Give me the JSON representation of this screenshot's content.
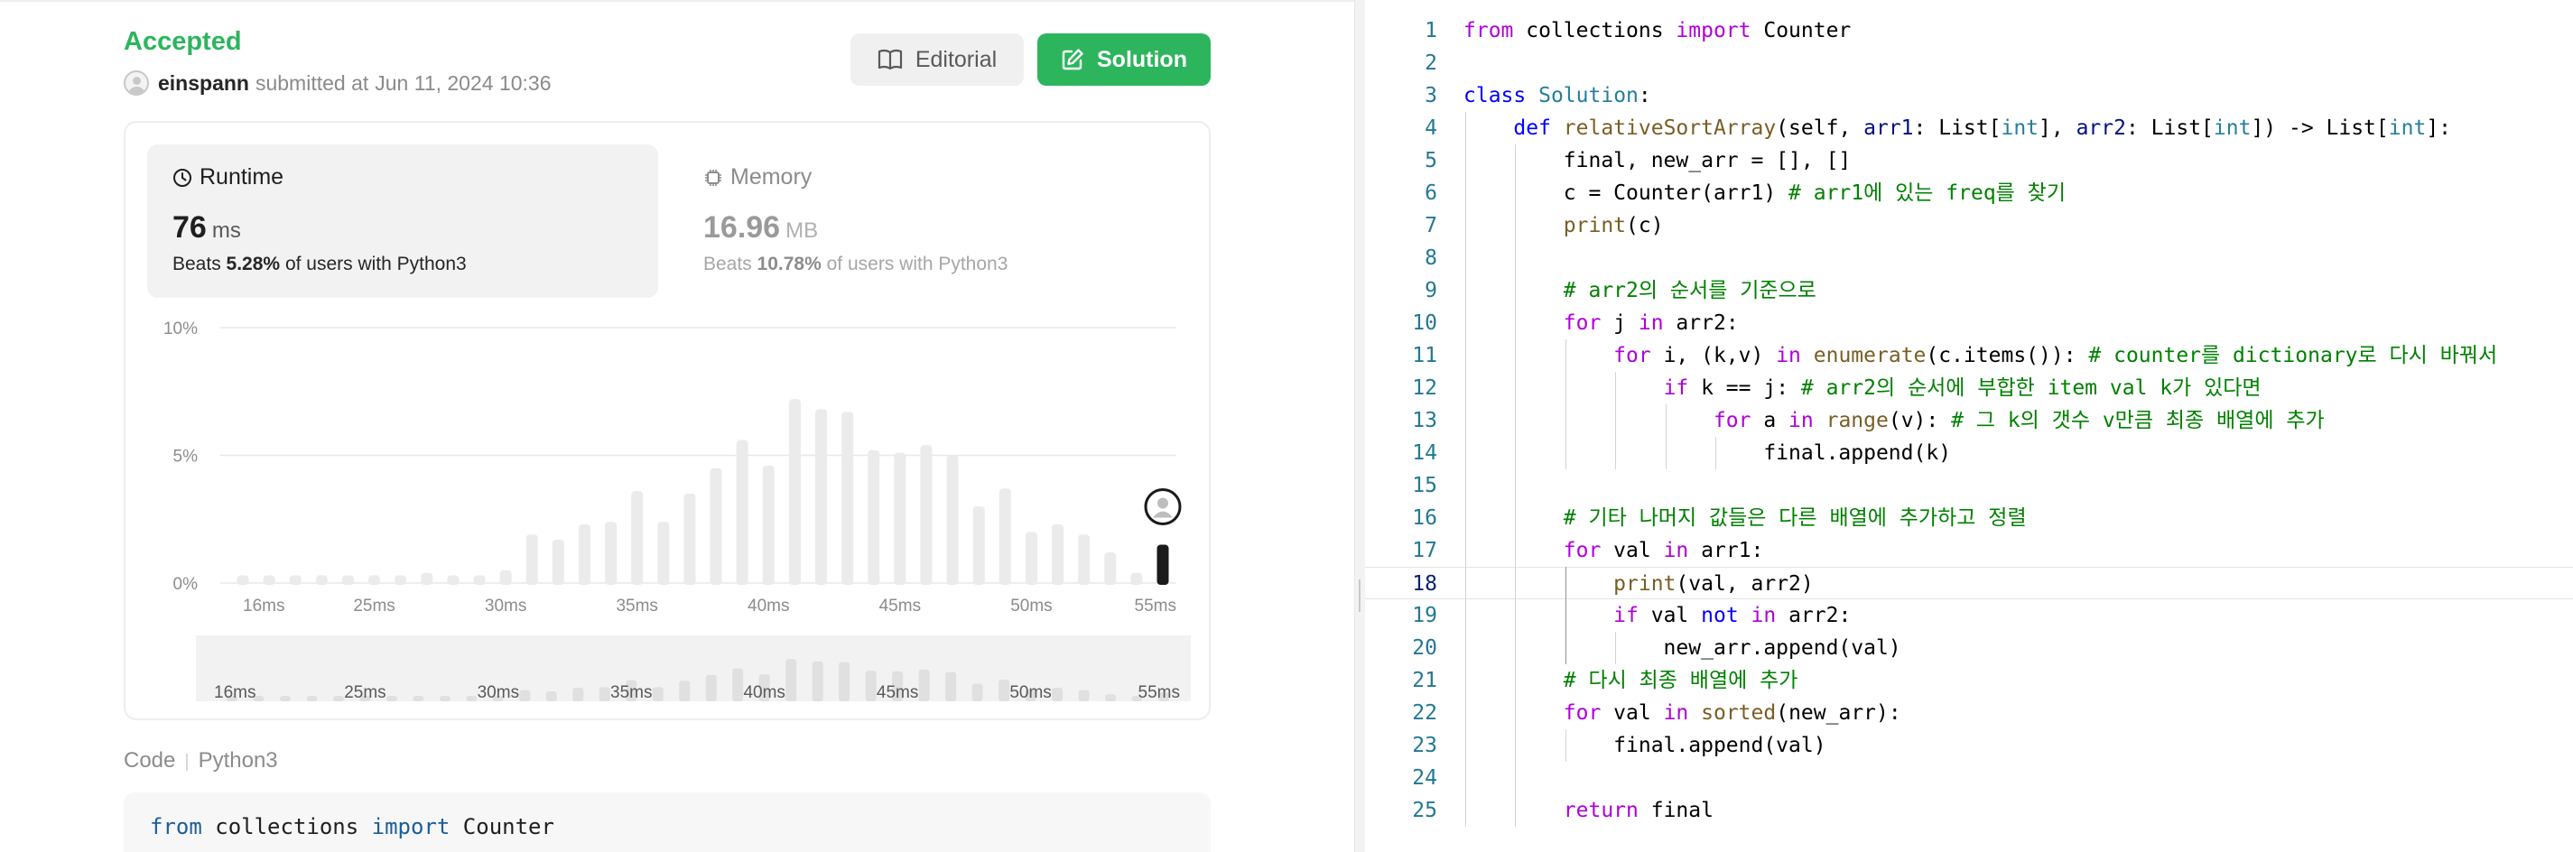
{
  "submission": {
    "status": "Accepted",
    "username": "einspann",
    "submitted_text": "submitted at",
    "datetime": "Jun 11, 2024 10:36"
  },
  "buttons": {
    "editorial": "Editorial",
    "solution": "Solution"
  },
  "runtime": {
    "label": "Runtime",
    "value": "76",
    "unit": "ms",
    "beats_prefix": "Beats",
    "beats_pct": "5.28%",
    "beats_suffix": "of users with Python3"
  },
  "memory": {
    "label": "Memory",
    "value": "16.96",
    "unit": "MB",
    "beats_prefix": "Beats",
    "beats_pct": "10.78%",
    "beats_suffix": "of users with Python3"
  },
  "chart_data": {
    "type": "bar",
    "y_ticks": [
      "10%",
      "5%",
      "0%"
    ],
    "ylim": [
      0,
      10
    ],
    "x_ticks": [
      "16ms",
      "25ms",
      "30ms",
      "35ms",
      "40ms",
      "45ms",
      "50ms",
      "55ms"
    ],
    "values": [
      0.3,
      0.3,
      0.3,
      0.3,
      0.3,
      0.3,
      0.3,
      0.4,
      0.3,
      0.3,
      0.5,
      1.9,
      1.7,
      2.3,
      2.4,
      3.6,
      2.4,
      3.5,
      4.5,
      5.6,
      4.6,
      7.2,
      6.8,
      6.7,
      5.2,
      5.1,
      5.4,
      5.0,
      3.0,
      3.7,
      2.0,
      2.3,
      1.9,
      1.2,
      0.4,
      1.5
    ],
    "your_value_index": 35,
    "overview_ticks": [
      "16ms",
      "25ms",
      "30ms",
      "35ms",
      "40ms",
      "45ms",
      "50ms",
      "55ms"
    ]
  },
  "code_section": {
    "label": "Code",
    "language": "Python3"
  },
  "code_preview_line": [
    {
      "t": "from",
      "c": "#1b5e99"
    },
    {
      "t": " collections ",
      "c": "#1f1f1f"
    },
    {
      "t": "import",
      "c": "#1b5e99"
    },
    {
      "t": " Counter",
      "c": "#1f1f1f"
    }
  ],
  "editor": {
    "current_line": 18,
    "colors": {
      "keyword_control": "#af00db",
      "keyword_def": "#0000ff",
      "class_name": "#267f99",
      "function": "#795e26",
      "param": "#001080",
      "comment": "#008000",
      "plain": "#000000"
    },
    "lines": [
      [
        [
          "kw",
          "from"
        ],
        [
          "p",
          " collections "
        ],
        [
          "kw",
          "import"
        ],
        [
          "p",
          " Counter"
        ]
      ],
      [],
      [
        [
          "def",
          "class"
        ],
        [
          "p",
          " "
        ],
        [
          "cls",
          "Solution"
        ],
        [
          "p",
          ":"
        ]
      ],
      [
        [
          "p",
          "    "
        ],
        [
          "def",
          "def"
        ],
        [
          "p",
          " "
        ],
        [
          "fn",
          "relativeSortArray"
        ],
        [
          "p",
          "(self, "
        ],
        [
          "par",
          "arr1"
        ],
        [
          "p",
          ": List["
        ],
        [
          "cls",
          "int"
        ],
        [
          "p",
          "], "
        ],
        [
          "par",
          "arr2"
        ],
        [
          "p",
          ": List["
        ],
        [
          "cls",
          "int"
        ],
        [
          "p",
          "]) -> List["
        ],
        [
          "cls",
          "int"
        ],
        [
          "p",
          "]:"
        ]
      ],
      [
        [
          "p",
          "        final, new_arr = [], []"
        ]
      ],
      [
        [
          "p",
          "        c = Counter(arr1) "
        ],
        [
          "cm",
          "# arr1에 있는 freq를 찾기"
        ]
      ],
      [
        [
          "p",
          "        "
        ],
        [
          "fn",
          "print"
        ],
        [
          "p",
          "(c)"
        ]
      ],
      [],
      [
        [
          "p",
          "        "
        ],
        [
          "cm",
          "# arr2의 순서를 기준으로"
        ]
      ],
      [
        [
          "p",
          "        "
        ],
        [
          "kw",
          "for"
        ],
        [
          "p",
          " j "
        ],
        [
          "kw",
          "in"
        ],
        [
          "p",
          " arr2:"
        ]
      ],
      [
        [
          "p",
          "            "
        ],
        [
          "kw",
          "for"
        ],
        [
          "p",
          " i, (k,v) "
        ],
        [
          "kw",
          "in"
        ],
        [
          "p",
          " "
        ],
        [
          "fn",
          "enumerate"
        ],
        [
          "p",
          "(c.items()): "
        ],
        [
          "cm",
          "# counter를 dictionary로 다시 바꿔서"
        ]
      ],
      [
        [
          "p",
          "                "
        ],
        [
          "kw",
          "if"
        ],
        [
          "p",
          " k == j: "
        ],
        [
          "cm",
          "# arr2의 순서에 부합한 item val k가 있다면"
        ]
      ],
      [
        [
          "p",
          "                    "
        ],
        [
          "kw",
          "for"
        ],
        [
          "p",
          " a "
        ],
        [
          "kw",
          "in"
        ],
        [
          "p",
          " "
        ],
        [
          "fn",
          "range"
        ],
        [
          "p",
          "(v): "
        ],
        [
          "cm",
          "# 그 k의 갯수 v만큼 최종 배열에 추가"
        ]
      ],
      [
        [
          "p",
          "                        final.append(k)"
        ]
      ],
      [],
      [
        [
          "p",
          "        "
        ],
        [
          "cm",
          "# 기타 나머지 값들은 다른 배열에 추가하고 정렬"
        ]
      ],
      [
        [
          "p",
          "        "
        ],
        [
          "kw",
          "for"
        ],
        [
          "p",
          " val "
        ],
        [
          "kw",
          "in"
        ],
        [
          "p",
          " arr1:"
        ]
      ],
      [
        [
          "p",
          "            "
        ],
        [
          "fn",
          "print"
        ],
        [
          "p",
          "(val, arr2)"
        ]
      ],
      [
        [
          "p",
          "            "
        ],
        [
          "kw",
          "if"
        ],
        [
          "p",
          " val "
        ],
        [
          "def",
          "not"
        ],
        [
          "p",
          " "
        ],
        [
          "kw",
          "in"
        ],
        [
          "p",
          " arr2:"
        ]
      ],
      [
        [
          "p",
          "                new_arr.append(val)"
        ]
      ],
      [
        [
          "p",
          "        "
        ],
        [
          "cm",
          "# 다시 최종 배열에 추가"
        ]
      ],
      [
        [
          "p",
          "        "
        ],
        [
          "kw",
          "for"
        ],
        [
          "p",
          " val "
        ],
        [
          "kw",
          "in"
        ],
        [
          "p",
          " "
        ],
        [
          "fn",
          "sorted"
        ],
        [
          "p",
          "(new_arr):"
        ]
      ],
      [
        [
          "p",
          "            final.append(val)"
        ]
      ],
      [],
      [
        [
          "p",
          "        "
        ],
        [
          "kw",
          "return"
        ],
        [
          "p",
          " final"
        ]
      ]
    ]
  }
}
